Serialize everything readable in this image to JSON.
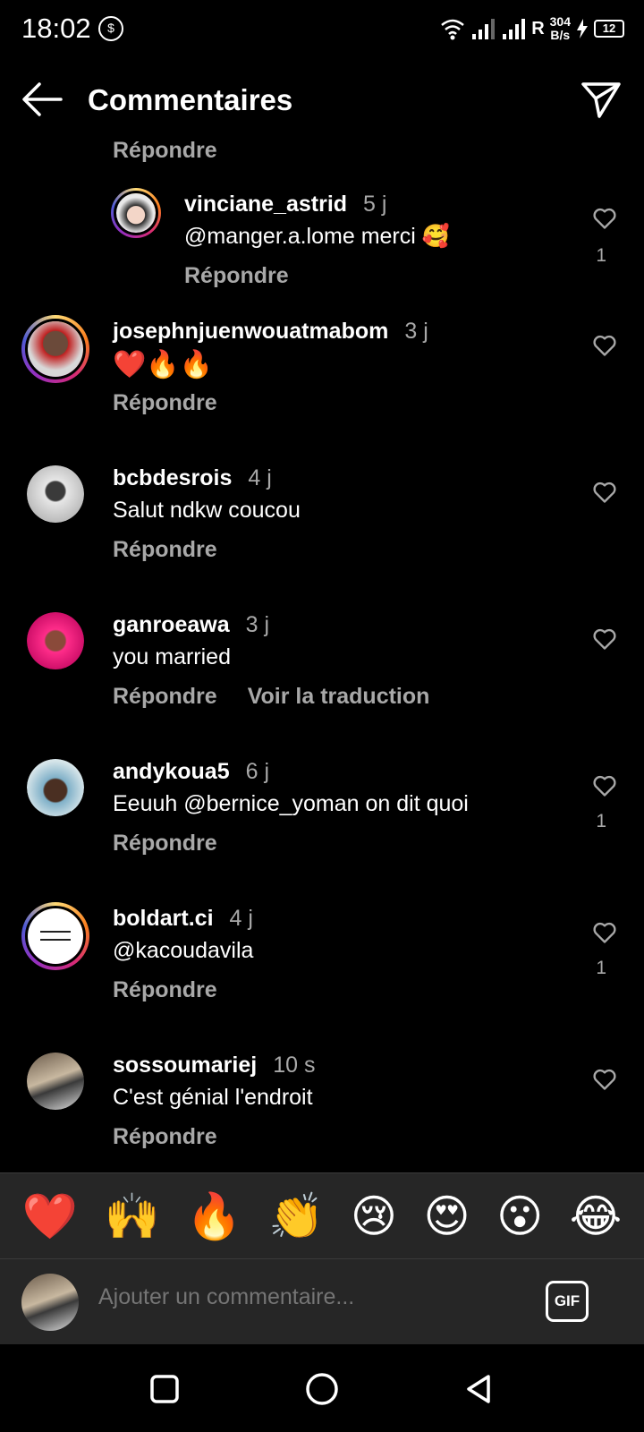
{
  "status_bar": {
    "time": "18:02",
    "network": "R",
    "speed_value": "304",
    "speed_unit": "B/s",
    "battery": "12"
  },
  "header": {
    "title": "Commentaires",
    "back_icon": "arrow-left-icon",
    "send_icon": "paper-plane-icon"
  },
  "partial_reply_label": "Répondre",
  "comments": [
    {
      "username": "vinciane_astrid",
      "time": "5 j",
      "text": "@manger.a.lome merci 🥰",
      "actions": [
        "Répondre"
      ],
      "likes": "1"
    },
    {
      "username": "josephnjuenwouatmabom",
      "time": "3 j",
      "text": "❤️🔥🔥",
      "actions": [
        "Répondre"
      ],
      "likes": ""
    },
    {
      "username": "bcbdesrois",
      "time": "4 j",
      "text": "Salut ndkw coucou",
      "actions": [
        "Répondre"
      ],
      "likes": ""
    },
    {
      "username": "ganroeawa",
      "time": "3 j",
      "text": "you married",
      "actions": [
        "Répondre",
        "Voir la traduction"
      ],
      "likes": ""
    },
    {
      "username": "andykoua5",
      "time": "6 j",
      "text": "Eeuuh @bernice_yoman on dit quoi",
      "actions": [
        "Répondre"
      ],
      "likes": "1"
    },
    {
      "username": "boldart.ci",
      "time": "4 j",
      "text": "@kacoudavila",
      "actions": [
        "Répondre"
      ],
      "likes": "1"
    },
    {
      "username": "sossoumariej",
      "time": "10 s",
      "text": "C'est génial l'endroit",
      "actions": [
        "Répondre"
      ],
      "likes": ""
    }
  ],
  "emoji_bar": [
    "❤️",
    "🙌",
    "🔥",
    "👏",
    "😢",
    "😍",
    "😮",
    "😂"
  ],
  "comment_input": {
    "placeholder": "Ajouter un commentaire...",
    "gif_label": "GIF"
  },
  "nav": {
    "recents": "square-icon",
    "home": "circle-icon",
    "back": "triangle-back-icon"
  },
  "colors": {
    "background": "#000000",
    "secondary_text": "#a8a8a8",
    "bar_background": "#262626"
  }
}
